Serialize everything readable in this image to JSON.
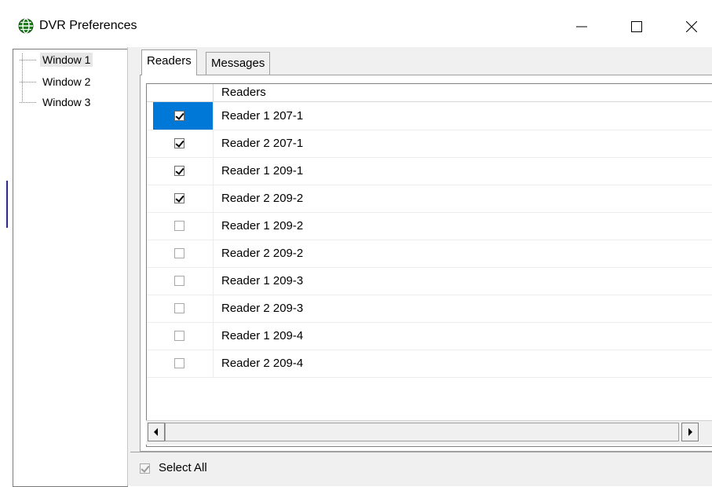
{
  "window": {
    "title": "DVR Preferences",
    "icon": "globe-icon",
    "controls": [
      "minimize-icon",
      "maximize-icon",
      "close-icon"
    ]
  },
  "tree": {
    "items": [
      {
        "label": "Window 1",
        "selected": true
      },
      {
        "label": "Window 2",
        "selected": false
      },
      {
        "label": "Window 3",
        "selected": false
      }
    ]
  },
  "tabs": [
    {
      "label": "Readers",
      "active": true
    },
    {
      "label": "Messages",
      "active": false
    }
  ],
  "grid": {
    "columns": [
      "",
      "Readers"
    ],
    "rows": [
      {
        "checked": true,
        "reader": "Reader 1 207-1",
        "current": true
      },
      {
        "checked": true,
        "reader": "Reader 2 207-1",
        "current": false
      },
      {
        "checked": true,
        "reader": "Reader 1 209-1",
        "current": false
      },
      {
        "checked": true,
        "reader": "Reader 2 209-2",
        "current": false
      },
      {
        "checked": false,
        "reader": "Reader 1 209-2",
        "current": false
      },
      {
        "checked": false,
        "reader": "Reader 2 209-2",
        "current": false
      },
      {
        "checked": false,
        "reader": "Reader 1 209-3",
        "current": false
      },
      {
        "checked": false,
        "reader": "Reader 2 209-3",
        "current": false
      },
      {
        "checked": false,
        "reader": "Reader 1 209-4",
        "current": false
      },
      {
        "checked": false,
        "reader": "Reader 2 209-4",
        "current": false
      }
    ],
    "selected_color": "#0078d7"
  },
  "footer": {
    "select_all_label": "Select All",
    "select_all_checked": true,
    "select_all_disabled": true
  }
}
